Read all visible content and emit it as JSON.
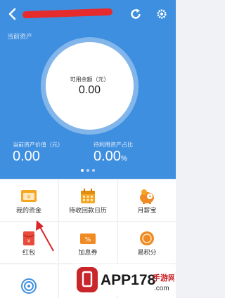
{
  "header": {
    "back_icon": "back-arrow-icon",
    "refresh_icon": "refresh-icon",
    "settings_icon": "settings-icon"
  },
  "hero": {
    "section_label": "当前资产",
    "available_balance_label": "可用余额（元）",
    "available_balance_value": "0.00",
    "asset_value_label": "当前资产价值（元）",
    "asset_value": "0.00",
    "pending_ratio_label": "待利用资产占比",
    "pending_ratio_value": "0.00",
    "pending_ratio_unit": "%",
    "carousel_pages": 3,
    "carousel_active": 1
  },
  "grid": {
    "items": [
      {
        "label": "我的资金",
        "icon": "funds-icon",
        "color": "#f5a623"
      },
      {
        "label": "待收回款日历",
        "icon": "calendar-icon",
        "color": "#f5a623"
      },
      {
        "label": "月薪宝",
        "icon": "piggy-bank-icon",
        "color": "#f08a24"
      },
      {
        "label": "红包",
        "icon": "red-packet-icon",
        "color": "#e84b3c"
      },
      {
        "label": "加息券",
        "icon": "coupon-icon",
        "color": "#f08a24"
      },
      {
        "label": "易积分",
        "icon": "points-icon",
        "color": "#f08a24"
      },
      {
        "label": "",
        "icon": "target-icon",
        "color": "#3f8fe0"
      }
    ]
  },
  "colors": {
    "hero_blue": "#3f8fe0",
    "annotation_red": "#d9252a"
  },
  "watermark": {
    "brand": "APP178",
    "suffix": "手游网",
    "domain": ".com"
  }
}
